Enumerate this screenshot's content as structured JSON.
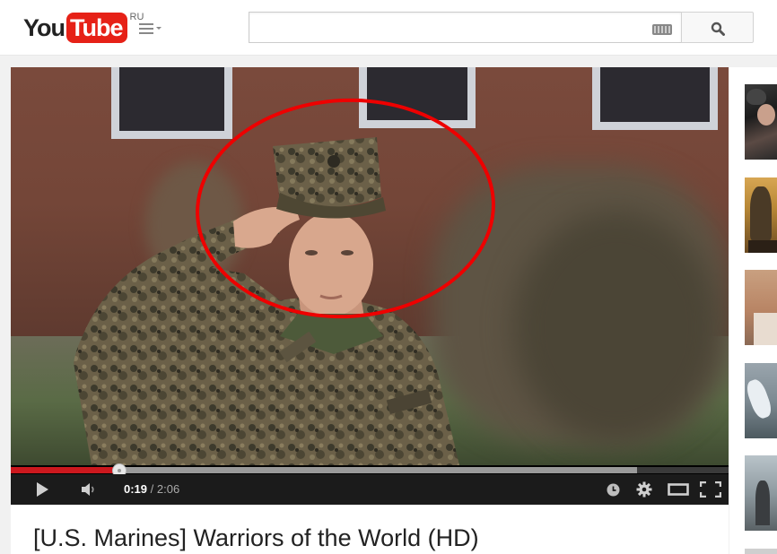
{
  "header": {
    "logo_you": "You",
    "logo_tube": "Tube",
    "logo_region": "RU",
    "guide_icon": "menu-icon",
    "search": {
      "value": "",
      "placeholder": "",
      "keyboard_icon": "keyboard-icon",
      "button_icon": "search-icon"
    }
  },
  "player": {
    "current_time": "0:19",
    "separator": "/",
    "duration": "2:06",
    "progress_played": 0.151,
    "progress_buffered": 0.872,
    "icons": {
      "play": "play-icon",
      "volume": "volume-icon",
      "watch_later": "clock-icon",
      "settings": "gear-icon",
      "theater": "theater-mode-icon",
      "fullscreen": "fullscreen-icon"
    }
  },
  "video": {
    "title": "[U.S. Marines] Warriors of the World (HD)",
    "annotation": "red-circle-highlight",
    "colors": {
      "highlight": "#e00000",
      "progress": "#cc181e"
    }
  },
  "sidebar": {
    "thumbnails": [
      {
        "name": "related-video-1"
      },
      {
        "name": "related-video-2"
      },
      {
        "name": "related-video-3"
      },
      {
        "name": "related-video-4"
      },
      {
        "name": "related-video-5"
      }
    ]
  },
  "colors": {
    "brand_red": "#e62117",
    "page_bg": "#f1f1f1"
  }
}
